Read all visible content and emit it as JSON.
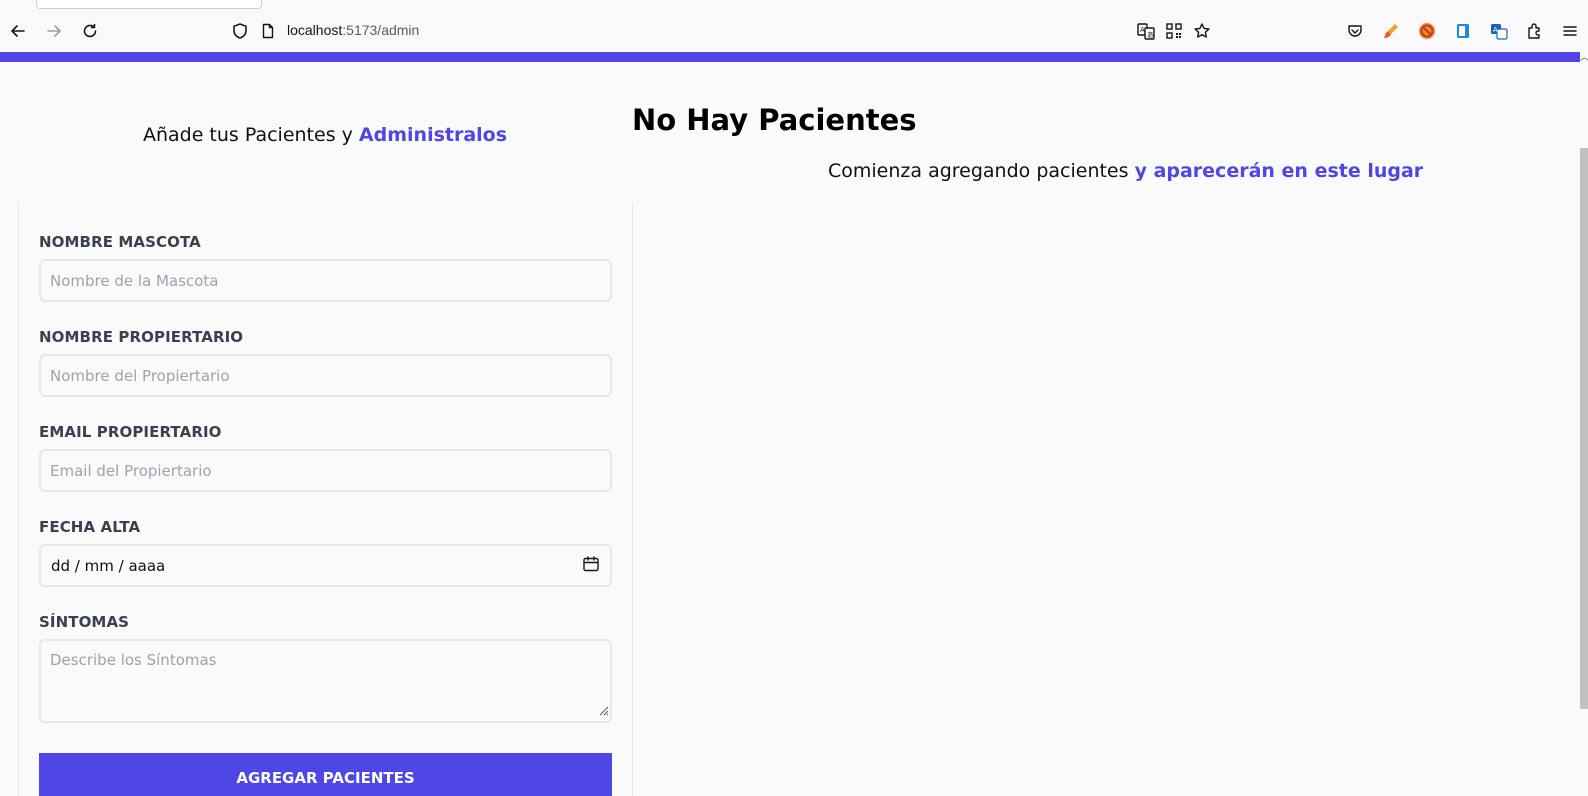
{
  "browser": {
    "url_host": "localhost",
    "url_rest": ":5173/admin",
    "icons": {
      "back": "arrow-left-icon",
      "forward": "arrow-right-icon",
      "reload": "reload-icon",
      "shield": "shield-icon",
      "page": "page-icon",
      "translate": "translate-icon",
      "qr": "qr-code-icon",
      "bookmark": "star-icon",
      "pocket": "pocket-icon",
      "extensions": [
        "paint-brush-icon",
        "block-icon",
        "book-icon",
        "language-icon",
        "puzzle-icon"
      ],
      "menu": "hamburger-menu-icon"
    }
  },
  "colors": {
    "accent": "#4f46e5",
    "background": "#fafafa",
    "label": "#374151",
    "placeholder": "#9ca3af",
    "border": "#e5e7eb"
  },
  "form_section": {
    "heading_prefix": "Añade tus Pacientes y ",
    "heading_accent": "Administralos"
  },
  "form": {
    "pet_name": {
      "label": "NOMBRE MASCOTA",
      "placeholder": "Nombre de la Mascota",
      "value": ""
    },
    "owner_name": {
      "label": "NOMBRE PROPIERTARIO",
      "placeholder": "Nombre del Propiertario",
      "value": ""
    },
    "owner_email": {
      "label": "EMAIL PROPIERTARIO",
      "placeholder": "Email del Propiertario",
      "value": ""
    },
    "date": {
      "label": "FECHA ALTA",
      "display": "dd / mm / aaaa"
    },
    "symptoms": {
      "label": "SÍNTOMAS",
      "placeholder": "Describe los Síntomas",
      "value": ""
    },
    "submit_label": "AGREGAR PACIENTES"
  },
  "list_section": {
    "title": "No Hay Pacientes",
    "subtitle_prefix": "Comienza agregando pacientes ",
    "subtitle_accent": "y aparecerán en este lugar"
  }
}
